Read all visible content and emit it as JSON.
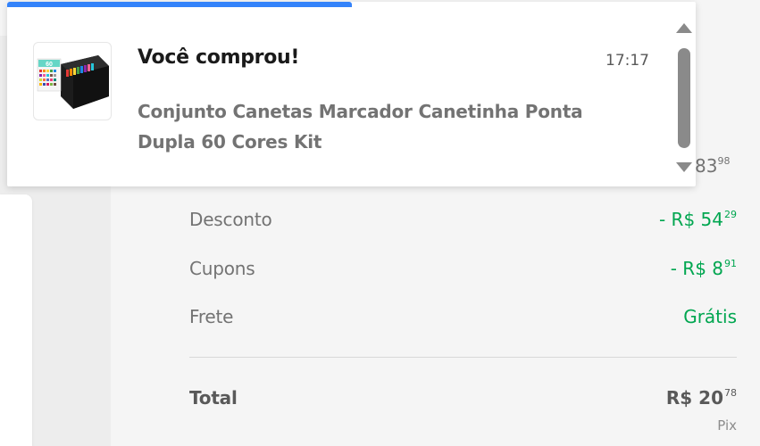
{
  "notification": {
    "title": "Você comprou!",
    "time": "17:17",
    "description": "Conjunto Canetas Marcador Canetinha Ponta Dupla 60 Cores Kit",
    "image_badge": "60",
    "image_icon": "marker-set-product-image"
  },
  "summary": {
    "partial_price_int": "83",
    "partial_price_cents": "98",
    "discount_label": "Desconto",
    "discount_value": "- R$ 54",
    "discount_cents": "29",
    "coupons_label": "Cupons",
    "coupons_value": "- R$ 8",
    "coupons_cents": "91",
    "shipping_label": "Frete",
    "shipping_value": "Grátis",
    "total_label": "Total",
    "total_value": "R$ 20",
    "total_cents": "78",
    "payment_method": "Pix"
  },
  "colors": {
    "accent": "#3483fa",
    "green": "#00a650",
    "text_muted": "#737373"
  }
}
